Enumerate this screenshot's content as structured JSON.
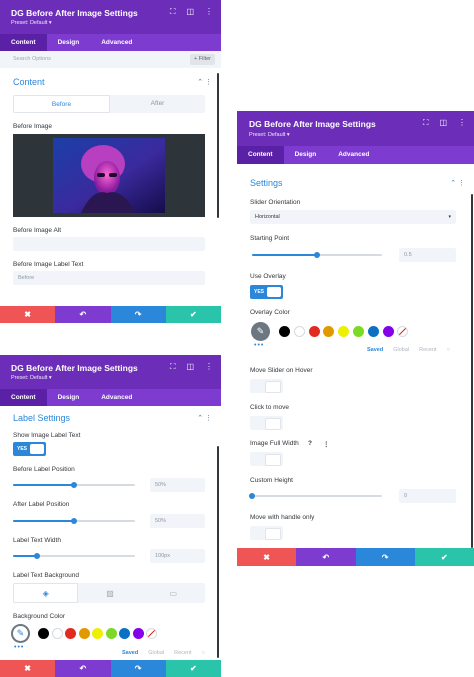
{
  "panel1": {
    "title": "DG Before After Image Settings",
    "preset": "Preset: Default ▾",
    "tabs": [
      "Content",
      "Design",
      "Advanced"
    ],
    "search_placeholder": "Search Options",
    "filter_label": "+ Filter",
    "section_title": "Content",
    "section_ctrl": "⌃ ⋮",
    "seg_before": "Before",
    "seg_after": "After",
    "before_image_label": "Before Image",
    "before_image_alt_label": "Before Image Alt",
    "before_image_label_text_label": "Before Image Label Text",
    "before_image_label_text_value": "Before"
  },
  "panel2": {
    "title": "DG Before After Image Settings",
    "preset": "Preset: Default ▾",
    "tabs": [
      "Content",
      "Design",
      "Advanced"
    ],
    "section_title": "Settings",
    "section_ctrl": "⌃ ⋮",
    "slider_orientation_label": "Slider Orientation",
    "slider_orientation_value": "Horizontal",
    "starting_point_label": "Starting Point",
    "starting_point_value": "0.5",
    "starting_point_fraction": 0.5,
    "use_overlay_label": "Use Overlay",
    "use_overlay_toggle": "YES",
    "overlay_color_label": "Overlay Color",
    "color_tabs": [
      "Saved",
      "Global",
      "Recent"
    ],
    "move_slider_hover_label": "Move Slider on Hover",
    "click_to_move_label": "Click to move",
    "image_full_width_label": "Image Full Width",
    "image_full_width_help": "?",
    "image_full_width_menu": "⋮",
    "custom_height_label": "Custom Height",
    "custom_height_value": "0",
    "custom_height_fraction": 0,
    "move_handle_only_label": "Move with handle only"
  },
  "panel3": {
    "title": "DG Before After Image Settings",
    "preset": "Preset: Default ▾",
    "tabs": [
      "Content",
      "Design",
      "Advanced"
    ],
    "section_title": "Label Settings",
    "section_ctrl": "⌃ ⋮",
    "show_label_text_label": "Show Image Label Text",
    "show_label_toggle": "YES",
    "before_label_position_label": "Before Label Position",
    "before_label_position_value": "50%",
    "before_label_position_fraction": 0.5,
    "after_label_position_label": "After Label Position",
    "after_label_position_value": "50%",
    "after_label_position_fraction": 0.5,
    "label_text_width_label": "Label Text Width",
    "label_text_width_value": "100px",
    "label_text_width_fraction": 0.2,
    "label_text_background_label": "Label Text Background",
    "background_color_label": "Background Color",
    "color_tabs": [
      "Saved",
      "Global",
      "Recent"
    ]
  },
  "colors": {
    "swatches": [
      "#000000",
      "#ffffff",
      "#e02b20",
      "#e09900",
      "#edf000",
      "#7cda24",
      "#0c71c3",
      "#8300e9"
    ],
    "accent": "#2b87da",
    "header": "#6c2eb9"
  },
  "footer": {
    "cancel_icon": "✖",
    "undo_icon": "↶",
    "redo_icon": "↷",
    "save_icon": "✔"
  },
  "head_icons": {
    "expand": "⛶",
    "split": "◫",
    "more": "⋮"
  }
}
